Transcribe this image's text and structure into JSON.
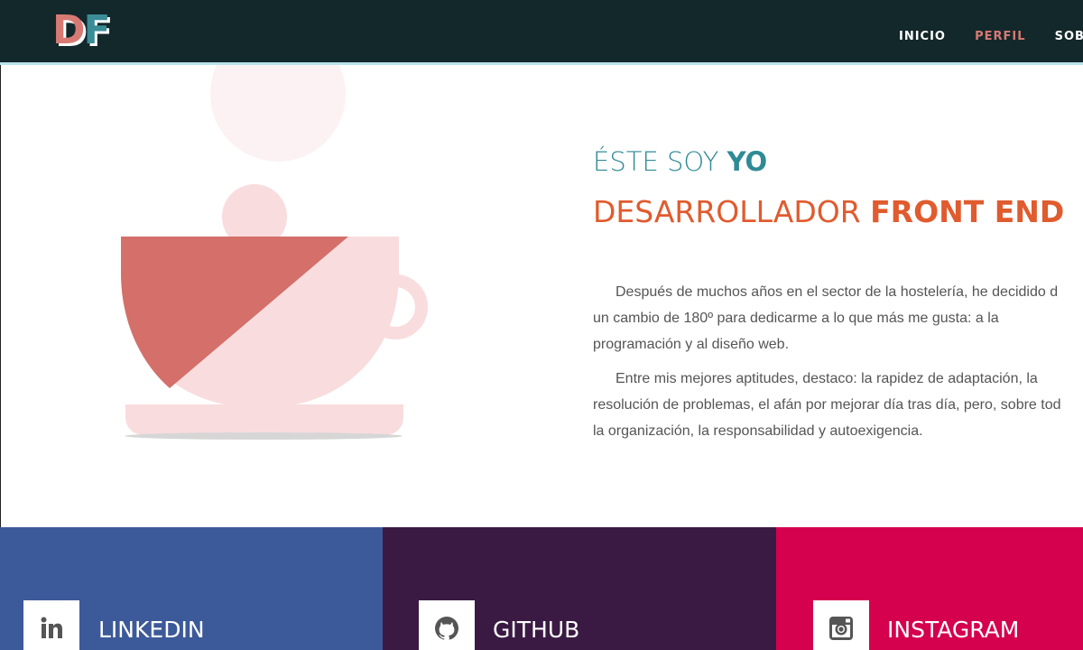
{
  "header": {
    "logo_d": "D",
    "logo_f": "F",
    "nav": [
      {
        "label": "INICIO"
      },
      {
        "label": "PERFIL",
        "active": true
      },
      {
        "label": "SOBRE"
      }
    ]
  },
  "hero": {
    "title_light": "ÉSTE SOY ",
    "title_bold": "YO",
    "subtitle_light": "DESARROLLADOR ",
    "subtitle_bold": "FRONT END",
    "p1_lines": [
      "Después de muchos años en el sector de la hostelería, he decidido d",
      "un cambio de 180º para dedicarme a lo que más me gusta: a la",
      "programación y al diseño web."
    ],
    "p2_lines": [
      "Entre mis mejores aptitudes, destaco: la rapidez de adaptación, la",
      "resolución de problemas, el afán por mejorar día tras día, pero, sobre tod",
      "la organización, la responsabilidad y autoexigencia."
    ]
  },
  "social": [
    {
      "label": "LINKEDIN",
      "icon": "linkedin-icon",
      "color": "#3c5a99"
    },
    {
      "label": "GITHUB",
      "icon": "github-icon",
      "color": "#3a1a42"
    },
    {
      "label": "INSTAGRAM",
      "icon": "instagram-icon",
      "color": "#d5004e"
    }
  ],
  "colors": {
    "header_bg": "#13282b",
    "accent_teal": "#2f8a96",
    "accent_orange": "#e05b2e",
    "accent_pink": "#d77a73"
  }
}
